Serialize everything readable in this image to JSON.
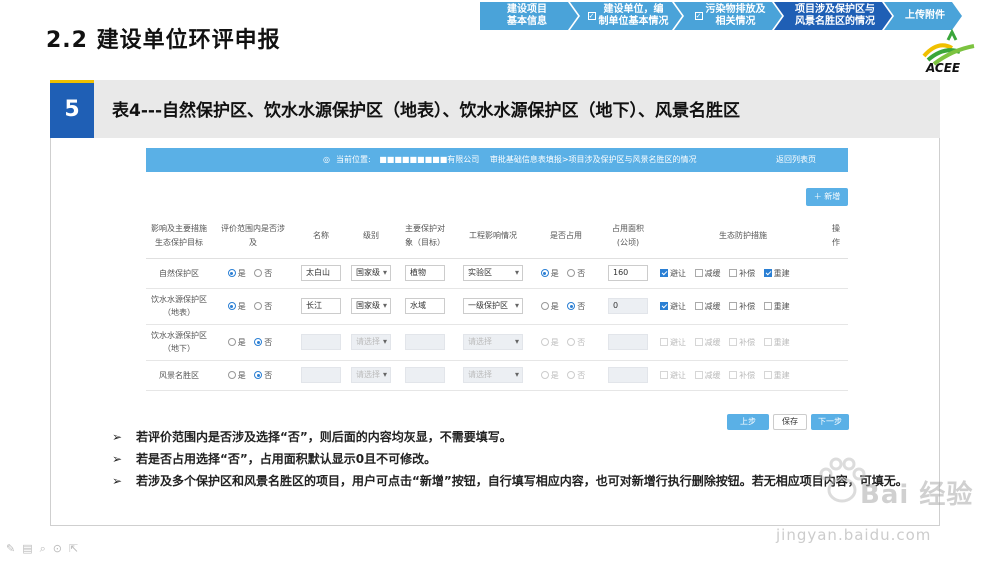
{
  "slide": {
    "title": "2.2  建设单位环评申报",
    "steps": [
      {
        "label": "建设项目\n基本信息",
        "check": false,
        "active": false
      },
      {
        "label": "建设单位，编\n制单位基本情况",
        "check": true,
        "active": false
      },
      {
        "label": "污染物排放及\n相关情况",
        "check": true,
        "active": false
      },
      {
        "label": "项目涉及保护区与\n风景名胜区的情况",
        "check": false,
        "active": true
      },
      {
        "label": "上传附件",
        "check": false,
        "active": false
      }
    ],
    "logo_text": "ACEE",
    "section_number": "5",
    "section_title": "表4---自然保护区、饮水水源保护区（地表）、饮水水源保护区（地下）、风景名胜区"
  },
  "app": {
    "location_prefix": "当前位置:",
    "company": "■■■■■■■■■有限公司",
    "breadcrumb": "审批基础信息表填报>项目涉及保护区与风景名胜区的情况",
    "back_label": "返回列表页",
    "add_label": "新增",
    "headers": [
      "影响及主要措施\n生态保护目标",
      "评价范围内是否涉\n及",
      "名称",
      "级别",
      "主要保护对\n象（目标）",
      "工程影响情况",
      "是否占用",
      "占用面积\n(公顷)",
      "生态防护措施",
      "操\n作"
    ],
    "yes": "是",
    "no": "否",
    "measures": [
      "避让",
      "减缓",
      "补偿",
      "重建"
    ],
    "placeholder_select": "请选择",
    "rows": [
      {
        "target": "自然保护区",
        "involved": "yes",
        "name": "太白山",
        "level": "国家级",
        "object": "植物",
        "impact": "实验区",
        "occupy": "yes",
        "area": "160",
        "measures": [
          true,
          false,
          false,
          true
        ],
        "disabled": false
      },
      {
        "target": "饮水水源保护区\n（地表）",
        "involved": "yes",
        "name": "长江",
        "level": "国家级",
        "object": "水域",
        "impact": "一级保护区",
        "occupy": "no",
        "area": "0",
        "measures": [
          true,
          false,
          false,
          false
        ],
        "disabled": false,
        "area_disabled": true
      },
      {
        "target": "饮水水源保护区\n（地下）",
        "involved": "no",
        "name": "",
        "level": "",
        "object": "",
        "impact": "",
        "occupy": "",
        "area": "",
        "measures": [
          false,
          false,
          false,
          false
        ],
        "disabled": true
      },
      {
        "target": "风景名胜区",
        "involved": "no",
        "name": "",
        "level": "",
        "object": "",
        "impact": "",
        "occupy": "",
        "area": "",
        "measures": [
          false,
          false,
          false,
          false
        ],
        "disabled": true
      }
    ],
    "prev_label": "上步",
    "save_label": "保存",
    "next_label": "下一步"
  },
  "notes": {
    "arrow": "➢",
    "items": [
      "若评价范围内是否涉及选择“否”，则后面的内容均灰显，不需要填写。",
      "若是否占用选择“否”，占用面积默认显示0且不可修改。",
      "若涉及多个保护区和风景名胜区的项目，用户可点击“新增”按钮，自行填写相应内容，也可对新增行执行删除按钮。若无相应项目内容，可填无。"
    ]
  },
  "watermark": {
    "text": "Bai 经验",
    "url": "jingyan.baidu.com"
  },
  "colors": {
    "primary": "#1f5fb5",
    "step": "#4aa3d9",
    "app_accent": "#5ab0e6",
    "band": "#e9e9e9",
    "accent_yellow": "#f0c000"
  }
}
